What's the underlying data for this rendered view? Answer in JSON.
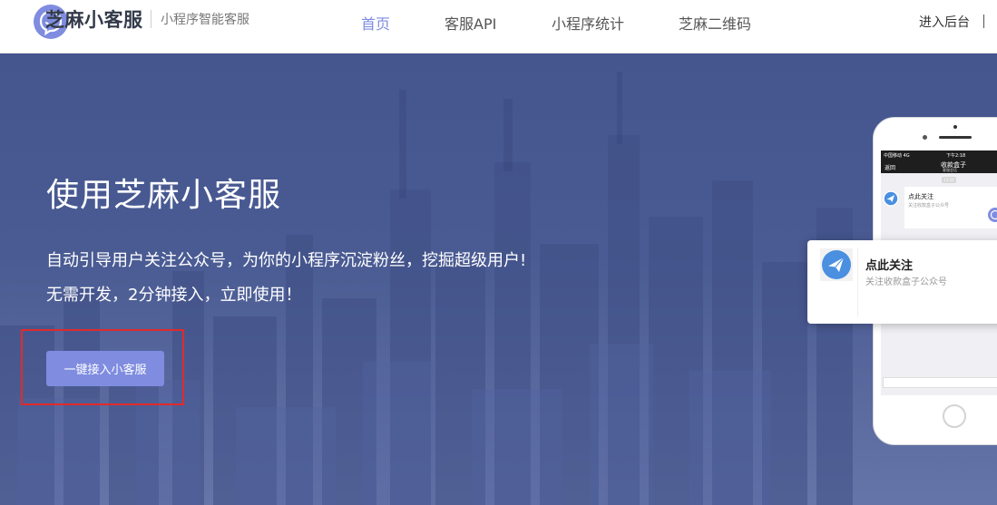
{
  "header": {
    "brand_name": "芝麻小客服",
    "tagline": "小程序智能客服",
    "nav": [
      {
        "label": "首页",
        "active": true
      },
      {
        "label": "客服API",
        "active": false
      },
      {
        "label": "小程序统计",
        "active": false
      },
      {
        "label": "芝麻二维码",
        "active": false
      }
    ],
    "login_label": "进入后台"
  },
  "hero": {
    "title": "使用芝麻小客服",
    "desc_line1": "自动引导用户关注公众号，为你的小程序沉淀粉丝，挖掘超级用户!",
    "desc_line2": "无需开发，2分钟接入，立即使用！",
    "cta_label": "一键接入小客服"
  },
  "phone": {
    "status_carrier": "中国移动 4G",
    "status_time": "下午2:18",
    "back_label": "返回",
    "chat_title": "收款盒子",
    "chat_subtitle": "客服会话",
    "time_chip": "13:26",
    "card_title": "点此关注",
    "card_subtitle": "关注收款盒子公众号"
  },
  "popup": {
    "title": "点此关注",
    "subtitle": "关注收款盒子公众号"
  },
  "colors": {
    "accent": "#7f8ce0",
    "hero_bg": "#4a5b93",
    "highlight_border": "#e02b2b"
  },
  "icons": {
    "logo": "chat-bubble-smile-icon",
    "avatar": "paper-plane-icon"
  }
}
